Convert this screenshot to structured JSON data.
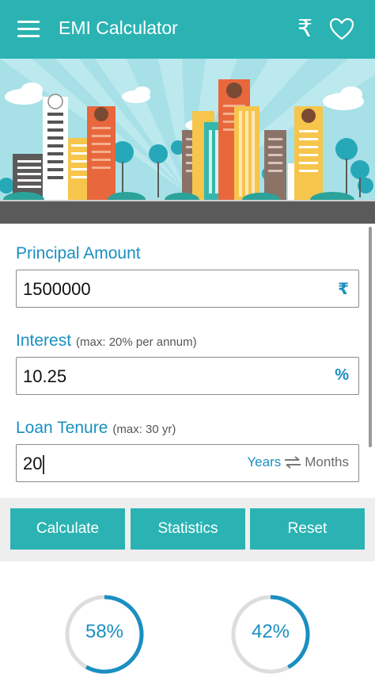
{
  "appbar": {
    "title": "EMI Calculator",
    "menu_icon": "hamburger-menu-icon",
    "currency_icon": "rupee-icon",
    "currency_symbol": "₹",
    "favorite_icon": "heart-outline-icon",
    "color": "#2bb3b3"
  },
  "form": {
    "principal": {
      "label": "Principal Amount",
      "value": "1500000",
      "suffix": "₹"
    },
    "interest": {
      "label": "Interest",
      "hint": "(max: 20% per annum)",
      "value": "10.25",
      "suffix": "%"
    },
    "tenure": {
      "label": "Loan Tenure",
      "hint": "(max: 30 yr)",
      "value": "20",
      "unit_selected": "Years",
      "unit_other": "Months",
      "toggle_icon": "swap-arrows-icon"
    }
  },
  "buttons": {
    "calculate": "Calculate",
    "statistics": "Statistics",
    "reset": "Reset"
  },
  "charts": [
    {
      "label": "58%",
      "percent": 58
    },
    {
      "label": "42%",
      "percent": 42
    }
  ],
  "colors": {
    "accent": "#2bb3b3",
    "label_blue": "#1a8fc1"
  }
}
